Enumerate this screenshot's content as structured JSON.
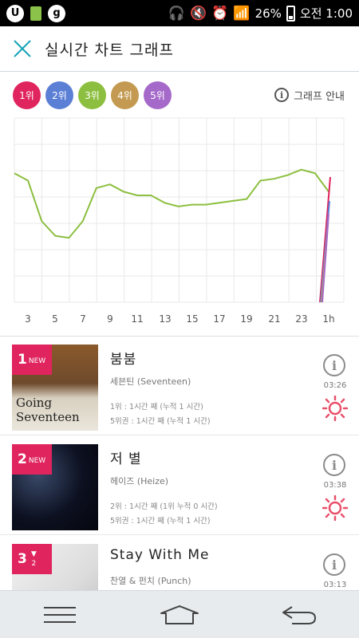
{
  "status_bar": {
    "battery": "26%",
    "time": "오전 1:00"
  },
  "header": {
    "title": "실시간 차트 그래프"
  },
  "ranks": [
    {
      "label": "1위",
      "color": "#e0245e"
    },
    {
      "label": "2위",
      "color": "#5c7fd6"
    },
    {
      "label": "3위",
      "color": "#8cbf3f"
    },
    {
      "label": "4위",
      "color": "#c49a52"
    },
    {
      "label": "5위",
      "color": "#a569c9"
    }
  ],
  "guide_label": "그래프 안내",
  "chart_data": {
    "type": "line",
    "x": [
      "3",
      "5",
      "7",
      "9",
      "11",
      "13",
      "15",
      "17",
      "19",
      "21",
      "23",
      "1h"
    ],
    "series": [
      {
        "values": [
          35,
          33,
          22,
          18,
          17.5,
          22,
          31,
          32,
          30,
          29,
          29,
          27,
          26,
          26.5,
          26.5,
          27,
          27.5,
          28,
          33,
          33.5,
          34.5,
          36,
          35,
          30
        ]
      }
    ]
  },
  "songs": [
    {
      "rank": "1",
      "badge": "NEW",
      "title": "붐붐",
      "artist": "세븐틴 (Seventeen)",
      "stat1": "1위 : 1시간 째 (누적 1 시간)",
      "stat2": "5위권 : 1시간 째 (누적 1 시간)",
      "time": "03:26",
      "cover_text": "Going\nSeventeen"
    },
    {
      "rank": "2",
      "badge": "NEW",
      "title": "저 별",
      "artist": "헤이즈 (Heize)",
      "stat1": "2위 : 1시간 째 (1위 누적 0 시간)",
      "stat2": "5위권 : 1시간 째 (누적 1 시간)",
      "time": "03:38"
    },
    {
      "rank": "3",
      "badge_change": "2",
      "title": "Stay With Me",
      "artist": "찬열 & 펀치 (Punch)",
      "time": "03:13"
    }
  ]
}
